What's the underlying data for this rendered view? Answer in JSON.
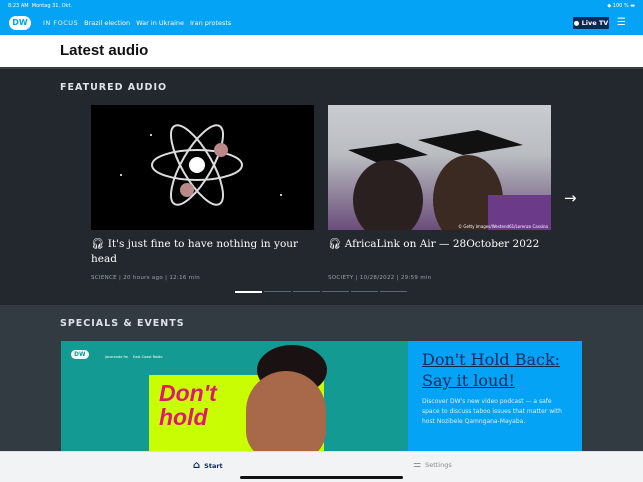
{
  "status": {
    "time": "8:23 AM",
    "date": "Montag 31. Okt.",
    "battery": "100 %"
  },
  "nav": {
    "logo": "DW",
    "in_focus": "IN FOCUS",
    "links": [
      "Brazil election",
      "War in Ukraine",
      "Iran protests"
    ],
    "live": "Live TV"
  },
  "page_title": "Latest audio",
  "featured": {
    "title": "FEATURED AUDIO",
    "cards": [
      {
        "title": "It's just fine to have nothing in your head",
        "category": "SCIENCE",
        "time": "20 hours ago",
        "duration": "12:16 min"
      },
      {
        "title": "AfricaLink on Air — 28October 2022",
        "category": "SOCIETY",
        "time": "10/28/2022",
        "duration": "29:59 min",
        "credit": "© Getty Images/Westend61/Lorenzo Cassina"
      }
    ],
    "sep": "|",
    "page_count": 6,
    "active_page": 1
  },
  "specials": {
    "title": "SPECIALS & EVENTS",
    "banner": {
      "heading": "Don't Hold Back: Say it loud!",
      "text": "Discover DW's new video podcast — a safe space to discuss taboo issues that matter with host Nozibele Qamngana-Mayaba.",
      "art_text": "Don't hold",
      "logos": [
        "DW",
        "jacaranda fm",
        "East Coast Radio"
      ]
    }
  },
  "tabs": {
    "start": "Start",
    "settings": "Settings"
  }
}
